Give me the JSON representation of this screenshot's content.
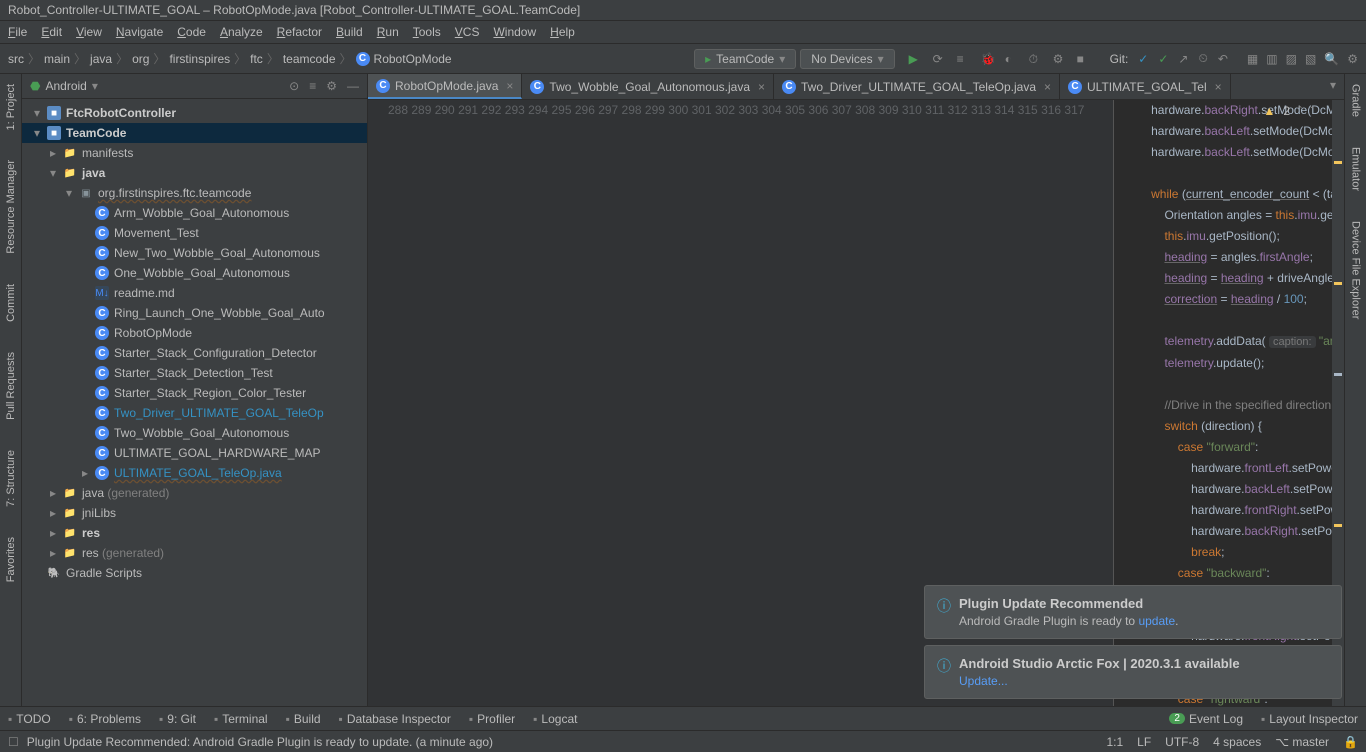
{
  "title": "Robot_Controller-ULTIMATE_GOAL – RobotOpMode.java [Robot_Controller-ULTIMATE_GOAL.TeamCode]",
  "menu": [
    "File",
    "Edit",
    "View",
    "Navigate",
    "Code",
    "Analyze",
    "Refactor",
    "Build",
    "Run",
    "Tools",
    "VCS",
    "Window",
    "Help"
  ],
  "breadcrumb": [
    "src",
    "main",
    "java",
    "org",
    "firstinspires",
    "ftc",
    "teamcode",
    "RobotOpMode"
  ],
  "run_config": "TeamCode",
  "device": "No Devices",
  "git_label": "Git:",
  "project_selector": "Android",
  "left_tools": [
    "1: Project",
    "Resource Manager",
    "Commit",
    "Pull Requests",
    "7: Structure",
    "Favorites"
  ],
  "right_tools": [
    "Gradle",
    "Emulator",
    "Device File Explorer"
  ],
  "tree": [
    {
      "d": 0,
      "a": "▾",
      "ic": "mod",
      "t": "FtcRobotController",
      "bold": true
    },
    {
      "d": 0,
      "a": "▾",
      "ic": "mod",
      "t": "TeamCode",
      "bold": true,
      "sel": true
    },
    {
      "d": 1,
      "a": "▸",
      "ic": "fold",
      "t": "manifests"
    },
    {
      "d": 1,
      "a": "▾",
      "ic": "fold",
      "t": "java",
      "bold": true
    },
    {
      "d": 2,
      "a": "▾",
      "ic": "pkg",
      "t": "org.firstinspires.ftc.teamcode",
      "wave": true
    },
    {
      "d": 3,
      "a": "",
      "ic": "c",
      "t": "Arm_Wobble_Goal_Autonomous"
    },
    {
      "d": 3,
      "a": "",
      "ic": "c",
      "t": "Movement_Test"
    },
    {
      "d": 3,
      "a": "",
      "ic": "c",
      "t": "New_Two_Wobble_Goal_Autonomous"
    },
    {
      "d": 3,
      "a": "",
      "ic": "c",
      "t": "One_Wobble_Goal_Autonomous"
    },
    {
      "d": 3,
      "a": "",
      "ic": "md",
      "t": "readme.md"
    },
    {
      "d": 3,
      "a": "",
      "ic": "c",
      "t": "Ring_Launch_One_Wobble_Goal_Auto"
    },
    {
      "d": 3,
      "a": "",
      "ic": "c",
      "t": "RobotOpMode"
    },
    {
      "d": 3,
      "a": "",
      "ic": "c",
      "t": "Starter_Stack_Configuration_Detector"
    },
    {
      "d": 3,
      "a": "",
      "ic": "c",
      "t": "Starter_Stack_Detection_Test"
    },
    {
      "d": 3,
      "a": "",
      "ic": "c",
      "t": "Starter_Stack_Region_Color_Tester"
    },
    {
      "d": 3,
      "a": "",
      "ic": "c",
      "t": "Two_Driver_ULTIMATE_GOAL_TeleOp",
      "teal": true
    },
    {
      "d": 3,
      "a": "",
      "ic": "c",
      "t": "Two_Wobble_Goal_Autonomous"
    },
    {
      "d": 3,
      "a": "",
      "ic": "c",
      "t": "ULTIMATE_GOAL_HARDWARE_MAP"
    },
    {
      "d": 3,
      "a": "▸",
      "ic": "c",
      "t": "ULTIMATE_GOAL_TeleOp.java",
      "teal": true,
      "wave": true
    },
    {
      "d": 1,
      "a": "▸",
      "ic": "fold",
      "t": "java",
      "gray": "(generated)"
    },
    {
      "d": 1,
      "a": "▸",
      "ic": "fold",
      "t": "jniLibs"
    },
    {
      "d": 1,
      "a": "▸",
      "ic": "fold",
      "t": "res",
      "bold": true
    },
    {
      "d": 1,
      "a": "▸",
      "ic": "fold",
      "t": "res",
      "gray": "(generated)"
    },
    {
      "d": 0,
      "a": "",
      "ic": "gradle",
      "t": "Gradle Scripts"
    }
  ],
  "tabs": [
    {
      "t": "RobotOpMode.java",
      "active": true,
      "ic": "c"
    },
    {
      "t": "Two_Wobble_Goal_Autonomous.java",
      "ic": "c"
    },
    {
      "t": "Two_Driver_ULTIMATE_GOAL_TeleOp.java",
      "ic": "c"
    },
    {
      "t": "ULTIMATE_GOAL_Tel",
      "ic": "c"
    }
  ],
  "inspect_warn": "2",
  "line_start": 289,
  "line_end": 317,
  "notifs": [
    {
      "title": "Plugin Update Recommended",
      "body": "Android Gradle Plugin is ready to ",
      "link": "update",
      "tail": "."
    },
    {
      "title": "Android Studio Arctic Fox | 2020.3.1 available",
      "link2": "Update..."
    }
  ],
  "bottom_tools": [
    "TODO",
    "6: Problems",
    "9: Git",
    "Terminal",
    "Build",
    "Database Inspector",
    "Profiler",
    "Logcat"
  ],
  "bottom_right": [
    "Event Log",
    "Layout Inspector"
  ],
  "event_badge": "2",
  "status_msg": "Plugin Update Recommended: Android Gradle Plugin is ready to update. (a minute ago)",
  "status_right": [
    "1:1",
    "LF",
    "UTF-8",
    "4 spaces",
    "master"
  ],
  "code_html": "        hardware.<span class='field'>backRight</span>.setMode(DcMotor.RunMode.<span class='static'>RUN_WITHOUT_ENCODER</span>);\n        hardware.<span class='field'>backLeft</span>.setMode(DcMotor.RunMode.<span class='static'>STOP_AND_RESET_ENCODER</span>);\n        hardware.<span class='field'>backLeft</span>.setMode(DcMotor.RunMode.<span class='static'>RUN_WITHOUT_ENCODER</span>);\n\n        <span class='kw'>while</span> (<span class='u'>current_encoder_count</span> &lt; (target_revolution_count * <span class='num'>1120</span>)) {\n            Orientation angles = <span class='kw'>this</span>.<span class='field'>imu</span>.getAngularOrientation(AxesReference.<span class='static'>INTRINSIC</span>, AxesOrder.<span class='static'>ZYX</span>, AngleUni\n            <span class='kw'>this</span>.<span class='field'>imu</span>.getPosition();\n            <span class='field u'>heading</span> = angles.<span class='field'>firstAngle</span>;                           <span class='com'>//Measure angle from gyroscope</span>\n            <span class='field u'>heading</span> = <span class='field u'>heading</span> + driveAngleOffset;                   <span class='com'>//Add drive offset to angle; used for driving wh</span>\n            <span class='field u'>correction</span> = <span class='field u'>heading</span> / <span class='num'>100</span>;\n\n            <span class='field'>telemetry</span>.addData( <span class='hint'>caption:</span> <span class='str'>\"angle\"</span>, <span class='field u'>heading</span>);\n            <span class='field'>telemetry</span>.update();\n\n            <span class='com'>//Drive in the specified direction</span>\n            <span class='kw'>switch</span> (direction) {\n                <span class='kw'>case</span> <span class='str'>\"forward\"</span>:\n                    hardware.<span class='field'>frontLeft</span>.setPower((speed / <span class='num'>100</span>) + <span class='field u'>correction</span>);\n                    hardware.<span class='field'>backLeft</span>.setPower((speed / <span class='num'>100</span>) + <span class='field u'>correction</span>);\n                    hardware.<span class='field'>frontRight</span>.setPower((speed / <span class='num'>100</span>) - <span class='field u'>correction</span>);\n                    hardware.<span class='field'>backRight</span>.setPower((speed / <span class='num'>100</span>) - <span class='field u'>correction</span>);\n                    <span class='kw'>break</span>;\n                <span class='kw'>case</span> <span class='str'>\"backward\"</span>:\n                    hardware.<span class='field'>frontLeft</span>.setPower(-(speed / <span class='num'>1</span>\n                    hardware.<span class='field'>backLeft</span>.setPower(-(speed / <span class='num'>10</span>\n                    hardware.<span class='field'>frontRight</span>.setPower(-(speed / \n                    hardware.<span class='field'>backRight</span>.setPower(-(speed / <span class='num'>1</span>\n                    <span class='kw'>break</span>;\n                <span class='kw'>case</span> <span class='str'>\"rightward\"</span>:"
}
